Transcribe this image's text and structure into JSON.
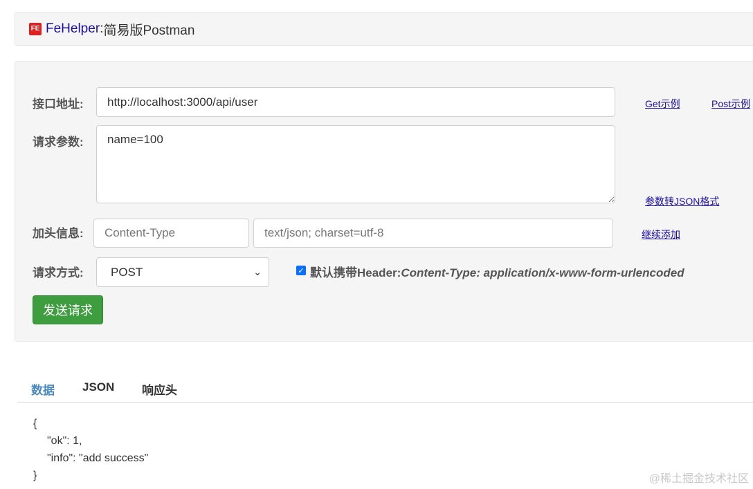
{
  "header": {
    "logo_text": "FE",
    "brand": "FeHelper",
    "separator": ":",
    "subtitle": "简易版Postman"
  },
  "form": {
    "url_label": "接口地址:",
    "url_value": "http://localhost:3000/api/user",
    "params_label": "请求参数:",
    "params_value": "name=100",
    "headers_label": "加头信息:",
    "header_key_placeholder": "Content-Type",
    "header_value_placeholder": "text/json; charset=utf-8",
    "method_label": "请求方式:",
    "method_value": "POST",
    "default_header_checked": true,
    "default_header_label": "默认携带Header:",
    "default_header_value": "Content-Type: application/x-www-form-urlencoded",
    "send_button": "发送请求"
  },
  "links": {
    "get_example": "Get示例",
    "post_example": "Post示例",
    "params_to_json": "参数转JSON格式",
    "add_more": "继续添加"
  },
  "tabs": [
    {
      "label": "数据",
      "active": true
    },
    {
      "label": "JSON",
      "active": false
    },
    {
      "label": "响应头",
      "active": false
    }
  ],
  "response": {
    "open": "{",
    "line1": "\"ok\": 1,",
    "line2": "\"info\": \"add success\"",
    "close": "}"
  },
  "watermark": "@稀土掘金技术社区",
  "colors": {
    "link": "#1a0dab",
    "send_button": "#3e9d3e",
    "active_tab": "#4a89c0",
    "checkbox": "#0d6efd"
  }
}
